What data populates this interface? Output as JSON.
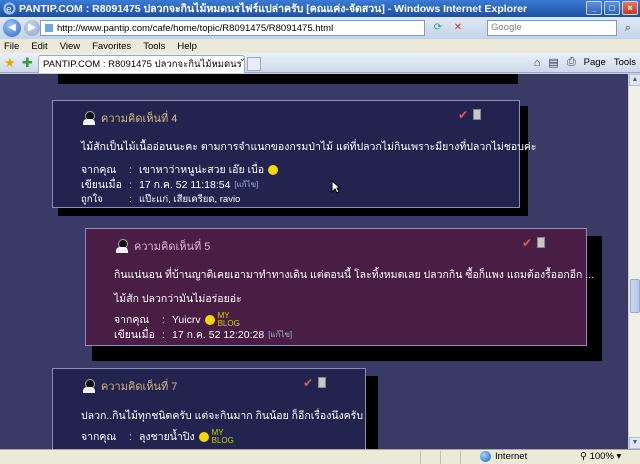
{
  "window": {
    "title": "PANTIP.COM : R8091475 ปลวกจะกินไม้หมดนรไฟร์แปล่าครับ [คณแค่ง-จัดสวน] - Windows Internet Explorer",
    "minimize": "_",
    "maximize": "□",
    "close": "×"
  },
  "address": {
    "url": "http://www.pantip.com/cafe/home/topic/R8091475/R8091475.html",
    "search_placeholder": "Google"
  },
  "menu": [
    "File",
    "Edit",
    "View",
    "Favorites",
    "Tools",
    "Help"
  ],
  "tab": {
    "label": "PANTIP.COM : R8091475 ปลวกจะกินไม้หมดนรไฟร์แป..."
  },
  "toolbar": {
    "page": "Page",
    "tools": "Tools"
  },
  "comments": [
    {
      "title": "ความคิดเห็นที่ 4",
      "body": [
        "ไม้สักเป็นไม้เนื้ออ่อนนะคะ ตามการจำแนกของกรมป่าไม้ แต่ที่ปลวกไม่กินเพราะมียางที่ปลวกไม่ชอบค่ะ"
      ],
      "from_label": "จากคุณ",
      "from": "เขาหาว่าหนูน่ะสวย เอ๊ย เบื่อ",
      "date_label": "เขียนเมื่อ",
      "date": "17 ก.ค. 52 11:18:54",
      "edit": "[แก้ไข]",
      "like_label": "ถูกใจ",
      "likes": "แป๊ะแก่, เสียเครียด, ravio"
    },
    {
      "title": "ความคิดเห็นที่ 5",
      "body": [
        "กินแน่นอน ที่บ้านญาติเคยเอามาทำทางเดิน แต่ตอนนี้ โละทิ้งหมดเลย ปลวกกิน ซื้อก็แพง แถมต้องรื้ออกอีก ...",
        "ไม้สัก ปลวกว่ามันไม่อร่อยอ่ะ"
      ],
      "from_label": "จากคุณ",
      "from": "Yuicrv",
      "date_label": "เขียนเมื่อ",
      "date": "17 ก.ค. 52 12:20:28",
      "edit": "[แก้ไข]",
      "badge": "MY\nBLOG"
    },
    {
      "title": "ความคิดเห็นที่ 7",
      "body": [
        "ปลวก..กินไม้ทุกชนิดครับ แต่จะกินมาก กินน้อย ก็อีกเรื่องนึงครับ"
      ],
      "from_label": "จากคุณ",
      "from": "ลุงชายน้ำปิง",
      "badge": "MY\nBLOG"
    }
  ],
  "status": {
    "zone": "Internet",
    "zoom": "100%"
  }
}
